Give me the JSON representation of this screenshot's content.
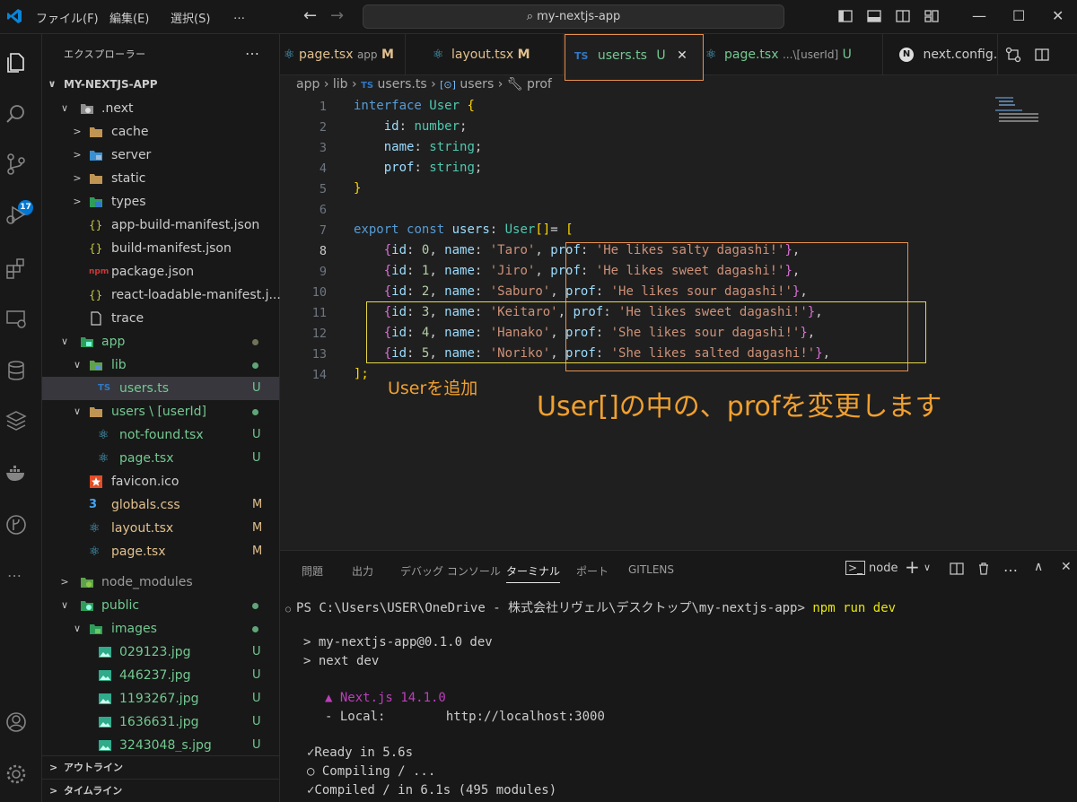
{
  "titlebar": {
    "menus": [
      "ファイル(F)",
      "編集(E)",
      "選択(S)",
      "…"
    ],
    "search": "my-nextjs-app",
    "colors": {
      "accent": "#0078d4"
    }
  },
  "activity": {
    "icons": [
      "explorer-icon",
      "search-icon",
      "source-control-icon",
      "run-debug-icon",
      "extensions-icon",
      "remote-explorer-icon",
      "database-icon",
      "layers-icon",
      "docker-icon",
      "gitlens-icon",
      "more-icon",
      "account-icon",
      "settings-gear-icon"
    ],
    "scm_badge": "17",
    "more": "…"
  },
  "sidebar": {
    "title": "エクスプローラー",
    "more": "…",
    "root": "MY-NEXTJS-APP",
    "items": [
      {
        "label": ".next"
      },
      {
        "label": "cache"
      },
      {
        "label": "server"
      },
      {
        "label": "static"
      },
      {
        "label": "types"
      },
      {
        "label": "app-build-manifest.json"
      },
      {
        "label": "build-manifest.json"
      },
      {
        "label": "package.json"
      },
      {
        "label": "react-loadable-manifest.j..."
      },
      {
        "label": "trace"
      },
      {
        "label": "app"
      },
      {
        "label": "lib"
      },
      {
        "label": "users.ts",
        "status": "U"
      },
      {
        "label": "users \\ [userId]"
      },
      {
        "label": "not-found.tsx",
        "status": "U"
      },
      {
        "label": "page.tsx",
        "status": "U"
      },
      {
        "label": "favicon.ico"
      },
      {
        "label": "globals.css",
        "status": "M"
      },
      {
        "label": "layout.tsx",
        "status": "M"
      },
      {
        "label": "page.tsx",
        "status": "M"
      },
      {
        "label": "node_modules"
      },
      {
        "label": "public"
      },
      {
        "label": "images"
      },
      {
        "label": "029123.jpg",
        "status": "U"
      },
      {
        "label": "446237.jpg",
        "status": "U"
      },
      {
        "label": "1193267.jpg",
        "status": "U"
      },
      {
        "label": "1636631.jpg",
        "status": "U"
      },
      {
        "label": "3243048_s.jpg",
        "status": "U"
      }
    ],
    "sections": [
      "アウトライン",
      "タイムライン"
    ]
  },
  "tabs": [
    {
      "label": "page.tsx",
      "tag": "app",
      "status": "M"
    },
    {
      "label": "layout.tsx",
      "status": "M"
    },
    {
      "label": "users.ts",
      "lang": "TS",
      "status": "U",
      "close": "✕"
    },
    {
      "label": "page.tsx",
      "tag": "...\\[userId]",
      "status": "U"
    },
    {
      "label": "next.config.js"
    }
  ],
  "breadcrumb": [
    "app",
    "lib",
    "users.ts",
    "users",
    "prof"
  ],
  "editor": {
    "line_numbers": [
      "1",
      "2",
      "3",
      "4",
      "5",
      "6",
      "7",
      "8",
      "9",
      "10",
      "11",
      "12",
      "13",
      "14"
    ],
    "current_line": "8",
    "code": {
      "l1_kw": "interface",
      "l1_type": "User",
      "l1_brace": "{",
      "l2_prop": "id",
      "l2_type": "number",
      "l3_prop": "name",
      "l3_type": "string",
      "l4_prop": "prof",
      "l4_type": "string",
      "l5_brace": "}",
      "l7_kw1": "export",
      "l7_kw2": "const",
      "l7_var": "users",
      "l7_type": "User",
      "l7_arr": "[]",
      "l7_open": "[",
      "rows": [
        {
          "id": "0",
          "name": "'Taro'",
          "prof": "'He likes salty dagashi!'"
        },
        {
          "id": "1",
          "name": "'Jiro'",
          "prof": "'He likes sweet dagashi!'"
        },
        {
          "id": "2",
          "name": "'Saburo'",
          "prof": "'He likes sour dagashi!'"
        },
        {
          "id": "3",
          "name": "'Keitaro'",
          "prof": "'He likes sweet dagashi!'"
        },
        {
          "id": "4",
          "name": "'Hanako'",
          "prof": "'She likes sour dagashi!'"
        },
        {
          "id": "5",
          "name": "'Noriko'",
          "prof": "'She likes salted dagashi!'"
        }
      ],
      "l14_close": "];"
    },
    "annotations": {
      "user_added": "Userを追加",
      "prof_changed": "User[]の中の、profを変更します"
    }
  },
  "panel": {
    "tabs": [
      "問題",
      "出力",
      "デバッグ コンソール",
      "ターミナル",
      "ポート",
      "GITLENS"
    ],
    "active_tab": "ターミナル",
    "shell": "node",
    "terminal": {
      "prompt": "PS C:\\Users\\USER\\OneDrive - 株式会社リヴェル\\デスクトップ\\my-nextjs-app>",
      "command": "npm run dev",
      "l1": "> my-nextjs-app@0.1.0 dev",
      "l2": "> next dev",
      "next_version": "▲ Next.js 14.1.0",
      "local_label": "- Local:",
      "local_url": "http://localhost:3000",
      "ready": "✓Ready in 5.6s",
      "compiling": "○ Compiling / ...",
      "compiled": "✓Compiled / in 6.1s (495 modules)"
    }
  }
}
